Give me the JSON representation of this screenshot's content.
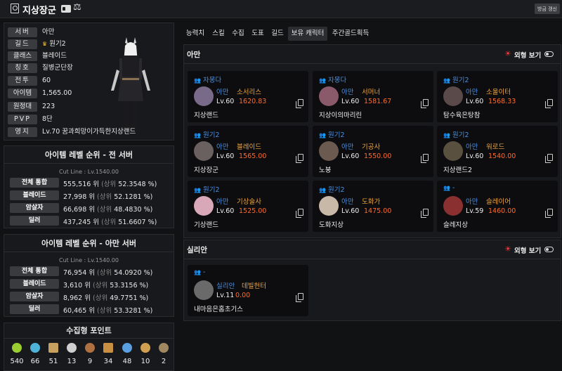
{
  "header": {
    "title": "지상장군",
    "scale_glyph": "⚖",
    "refresh_label": "방금 갱신"
  },
  "profile": {
    "rows": [
      {
        "label": "서버",
        "value": "아만"
      },
      {
        "label": "길드",
        "value": "원기2",
        "crown": "♛"
      },
      {
        "label": "클래스",
        "value": "블레이드"
      },
      {
        "label": "칭호",
        "value": "질병군단장"
      },
      {
        "label": "전투",
        "value": "60"
      },
      {
        "label": "아이템",
        "value": "1,565.00"
      },
      {
        "label": "원정대",
        "value": "223"
      },
      {
        "label": "PVP",
        "value": "8단"
      },
      {
        "label": "영지",
        "value": "Lv.70 꿈과희망이가득한지상랜드"
      }
    ]
  },
  "rank_all": {
    "title": "아이템 레벨 순위 - 전 서버",
    "cutline": "Cut Line : Lv.1540.00",
    "rows": [
      {
        "name": "전체 통합",
        "rank": "555,516 위",
        "paren": "(상위",
        "pct": "52.3548 %)"
      },
      {
        "name": "블레이드",
        "rank": "27,998 위",
        "paren": "(상위",
        "pct": "52.1281 %)"
      },
      {
        "name": "암살자",
        "rank": "66,698 위",
        "paren": "(상위",
        "pct": "48.4830 %)"
      },
      {
        "name": "딜러",
        "rank": "437,245 위",
        "paren": "(상위",
        "pct": "51.6607 %)"
      }
    ]
  },
  "rank_server": {
    "title": "아이템 레벨 순위 - 아만 서버",
    "cutline": "Cut Line : Lv.1540.00",
    "rows": [
      {
        "name": "전체 통합",
        "rank": "76,954 위",
        "paren": "(상위",
        "pct": "54.0920 %)"
      },
      {
        "name": "블레이드",
        "rank": "3,610 위",
        "paren": "(상위",
        "pct": "53.3156 %)"
      },
      {
        "name": "암살자",
        "rank": "8,962 위",
        "paren": "(상위",
        "pct": "49.7751 %)"
      },
      {
        "name": "딜러",
        "rank": "60,465 위",
        "paren": "(상위",
        "pct": "53.3281 %)"
      }
    ]
  },
  "collect": {
    "title": "수집형 포인트",
    "items": [
      {
        "icon": "mokoko-seed-icon",
        "value": "540",
        "color": "#9acd32"
      },
      {
        "icon": "island-heart-icon",
        "value": "66",
        "color": "#4fb3d9"
      },
      {
        "icon": "great-art-icon",
        "value": "51",
        "color": "#c8a060"
      },
      {
        "icon": "giant-heart-icon",
        "value": "13",
        "color": "#cfcfcf"
      },
      {
        "icon": "ignea-token-icon",
        "value": "9",
        "color": "#b07040"
      },
      {
        "icon": "adventure-book-icon",
        "value": "34",
        "color": "#c89040"
      },
      {
        "icon": "world-tree-leaf-icon",
        "value": "48",
        "color": "#5aa0e0"
      },
      {
        "icon": "orpheus-star-icon",
        "value": "10",
        "color": "#d0a050"
      },
      {
        "icon": "sea-bounty-icon",
        "value": "2",
        "color": "#a08860"
      }
    ]
  },
  "tabs": [
    "능력치",
    "스킬",
    "수집",
    "도표",
    "길드",
    "보유 캐릭터",
    "주간골드획득"
  ],
  "active_tab": "보유 캐릭터",
  "servers": [
    {
      "name": "아만",
      "look_label": "외형 보기",
      "characters": [
        {
          "guild": "자몽다",
          "server": "아만",
          "class": "소서리스",
          "level": "Lv.60",
          "item_level": "1620.83",
          "name": "지상랜드",
          "face": "#7a6a8a"
        },
        {
          "guild": "자몽다",
          "server": "아만",
          "class": "서머너",
          "level": "Lv.60",
          "item_level": "1581.67",
          "name": "지상이의마리린",
          "face": "#8a5a6a"
        },
        {
          "guild": "원기2",
          "server": "아만",
          "class": "소울이터",
          "level": "Lv.60",
          "item_level": "1568.33",
          "name": "탐수육은탕참",
          "face": "#5a4a4a"
        },
        {
          "guild": "원기2",
          "server": "아만",
          "class": "블레이드",
          "level": "Lv.60",
          "item_level": "1565.00",
          "name": "지상장군",
          "face": "#6a6060"
        },
        {
          "guild": "원기2",
          "server": "아만",
          "class": "기공사",
          "level": "Lv.60",
          "item_level": "1550.00",
          "name": "노붕",
          "face": "#6a5a50"
        },
        {
          "guild": "원기2",
          "server": "아만",
          "class": "워로드",
          "level": "Lv.60",
          "item_level": "1540.00",
          "name": "지상랜드2",
          "face": "#5a5040"
        },
        {
          "guild": "원기2",
          "server": "아만",
          "class": "기상술사",
          "level": "Lv.60",
          "item_level": "1525.00",
          "name": "기상랜드",
          "face": "#d8a8b8"
        },
        {
          "guild": "원기2",
          "server": "아만",
          "class": "도화가",
          "level": "Lv.60",
          "item_level": "1475.00",
          "name": "도화지상",
          "face": "#c8b8a8"
        },
        {
          "guild": "-",
          "server": "아만",
          "class": "슬레이어",
          "level": "Lv.59",
          "item_level": "1460.00",
          "name": "슬레지상",
          "face": "#8a3030"
        }
      ]
    },
    {
      "name": "실리안",
      "look_label": "외형 보기",
      "characters": [
        {
          "guild": "-",
          "server": "실리안",
          "class": "데빌헌터",
          "level": "Lv.11",
          "item_level": "0.00",
          "name": "내마음은홈초기스",
          "face": "#6a6a6a"
        }
      ]
    }
  ]
}
